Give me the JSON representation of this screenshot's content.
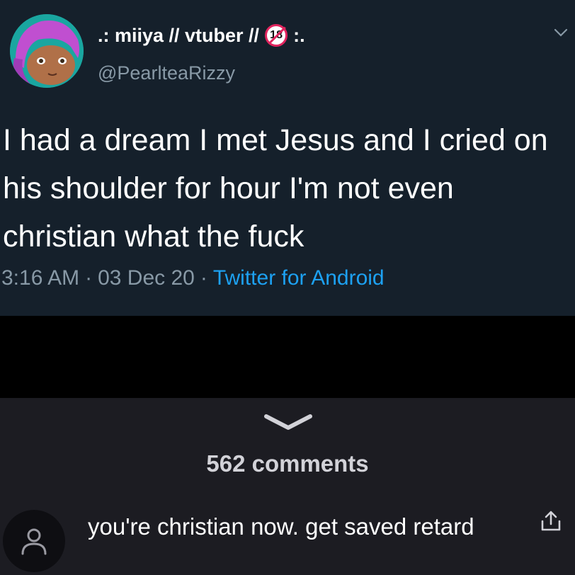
{
  "tweet": {
    "display_name": ".: miiya // vtuber //",
    "age_badge": "18",
    "name_suffix": ":.",
    "handle": "@PearlteaRizzy",
    "text": "I had a dream I met Jesus and I cried on his shoulder for hour I'm not even christian what the fuck",
    "time": "3:16 AM",
    "date": "03 Dec 20",
    "separator": "·",
    "source": "Twitter for Android"
  },
  "comments_panel": {
    "count_label": "562 comments",
    "first_comment": {
      "text": "you're christian now. get saved retard"
    }
  },
  "icons": {
    "tweet_menu": "chevron-down-icon",
    "collapse": "chevron-down-icon",
    "commenter_avatar": "user-icon",
    "share": "share-icon"
  },
  "colors": {
    "tweet_background": "#15202b",
    "link_blue": "#1da1f2",
    "muted_gray": "#8899a6",
    "comments_background": "#1c1c22"
  }
}
